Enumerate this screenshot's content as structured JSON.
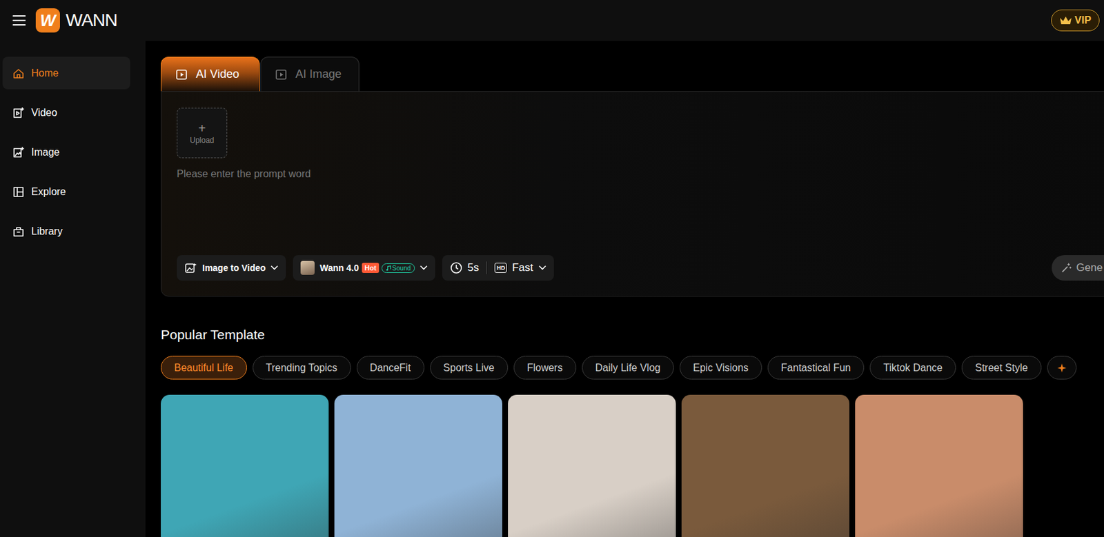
{
  "brand": {
    "logo": "W",
    "name": "WANN"
  },
  "vip": "VIP",
  "sidebar": {
    "items": [
      {
        "label": "Home",
        "selected": true
      },
      {
        "label": "Video",
        "selected": false
      },
      {
        "label": "Image",
        "selected": false
      },
      {
        "label": "Explore",
        "selected": false
      },
      {
        "label": "Library",
        "selected": false
      }
    ]
  },
  "tabs": [
    {
      "label": "AI Video",
      "selected": true
    },
    {
      "label": "AI Image",
      "selected": false
    }
  ],
  "upload": {
    "icon": "+",
    "label": "Upload"
  },
  "prompt": {
    "placeholder": "Please enter the prompt word"
  },
  "controls": {
    "mode": "Image to Video",
    "model": "Wann 4.0",
    "hot_badge": "Hot",
    "sound_badge": "Sound",
    "duration": "5s",
    "quality_icon": "HD",
    "quality": "Fast",
    "generate": "Gene"
  },
  "templates": {
    "title": "Popular Template",
    "chips": [
      {
        "label": "Beautiful Life",
        "selected": true
      },
      {
        "label": "Trending Topics",
        "selected": false
      },
      {
        "label": "DanceFit",
        "selected": false
      },
      {
        "label": "Sports Live",
        "selected": false
      },
      {
        "label": "Flowers",
        "selected": false
      },
      {
        "label": "Daily Life Vlog",
        "selected": false
      },
      {
        "label": "Epic Visions",
        "selected": false
      },
      {
        "label": "Fantastical Fun",
        "selected": false
      },
      {
        "label": "Tiktok Dance",
        "selected": false
      },
      {
        "label": "Street Style",
        "selected": false
      }
    ],
    "cards": [
      {
        "color": "#3fa6b5"
      },
      {
        "color": "#8fb3d6"
      },
      {
        "color": "#d8cfc6"
      },
      {
        "color": "#7a5a3c"
      },
      {
        "color": "#c98c6a"
      }
    ]
  }
}
